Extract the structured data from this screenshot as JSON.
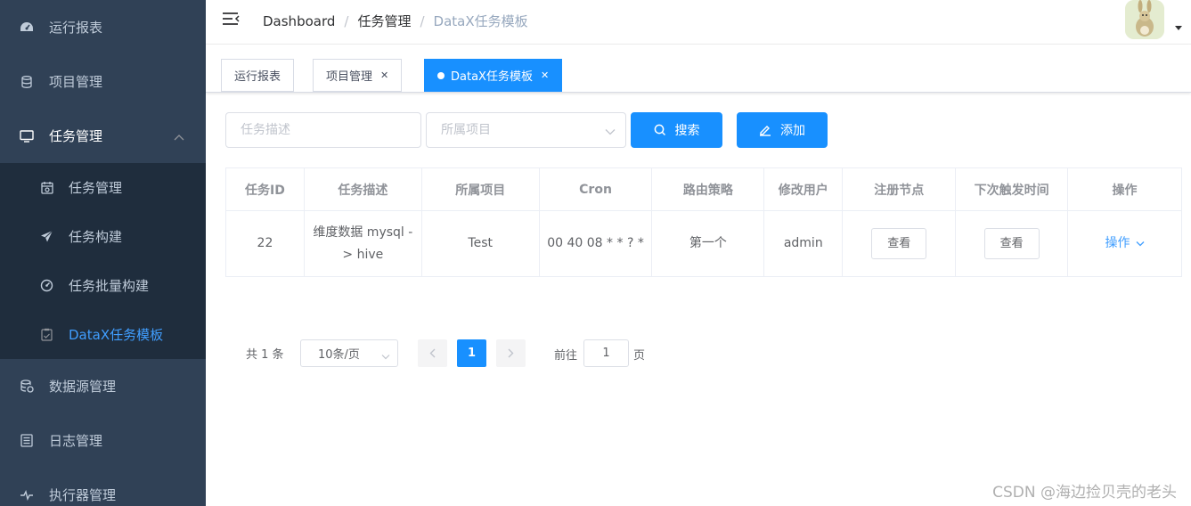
{
  "sidebar": {
    "items": [
      {
        "label": "运行报表",
        "icon": "dashboard-icon"
      },
      {
        "label": "项目管理",
        "icon": "database-icon"
      },
      {
        "label": "任务管理",
        "icon": "monitor-icon",
        "open": true
      }
    ],
    "submenu": [
      {
        "label": "任务管理",
        "icon": "calendar-icon"
      },
      {
        "label": "任务构建",
        "icon": "send-icon"
      },
      {
        "label": "任务批量构建",
        "icon": "gauge-icon"
      },
      {
        "label": "DataX任务模板",
        "icon": "clipboard-icon",
        "active": true
      }
    ],
    "items_after": [
      {
        "label": "数据源管理",
        "icon": "datasource-icon"
      },
      {
        "label": "日志管理",
        "icon": "document-icon"
      },
      {
        "label": "执行器管理",
        "icon": "executor-icon"
      }
    ],
    "colors": {
      "bg": "#304156",
      "submenu_bg": "#1f2d3d",
      "active": "#409eff"
    }
  },
  "navbar": {
    "breadcrumb": [
      "Dashboard",
      "任务管理",
      "DataX任务模板"
    ]
  },
  "tags": [
    {
      "label": "运行报表"
    },
    {
      "label": "项目管理",
      "closable": true
    },
    {
      "label": "DataX任务模板",
      "closable": true,
      "active": true
    }
  ],
  "filters": {
    "desc_placeholder": "任务描述",
    "project_placeholder": "所属项目",
    "search_label": "搜索",
    "add_label": "添加"
  },
  "table": {
    "headers": [
      "任务ID",
      "任务描述",
      "所属项目",
      "Cron",
      "路由策略",
      "修改用户",
      "注册节点",
      "下次触发时间",
      "操作"
    ],
    "rows": [
      {
        "id": "22",
        "desc": "维度数据 mysql -> hive",
        "project": "Test",
        "cron": "00 40 08 * * ? *",
        "route": "第一个",
        "user": "admin",
        "node_btn": "查看",
        "next_btn": "查看",
        "op": "操作"
      }
    ]
  },
  "pagination": {
    "total": "共 1 条",
    "page_size": "10条/页",
    "current": "1",
    "goto_prefix": "前往",
    "goto_value": "1",
    "goto_suffix": "页"
  },
  "watermark": "CSDN @海边捡贝壳的老头"
}
